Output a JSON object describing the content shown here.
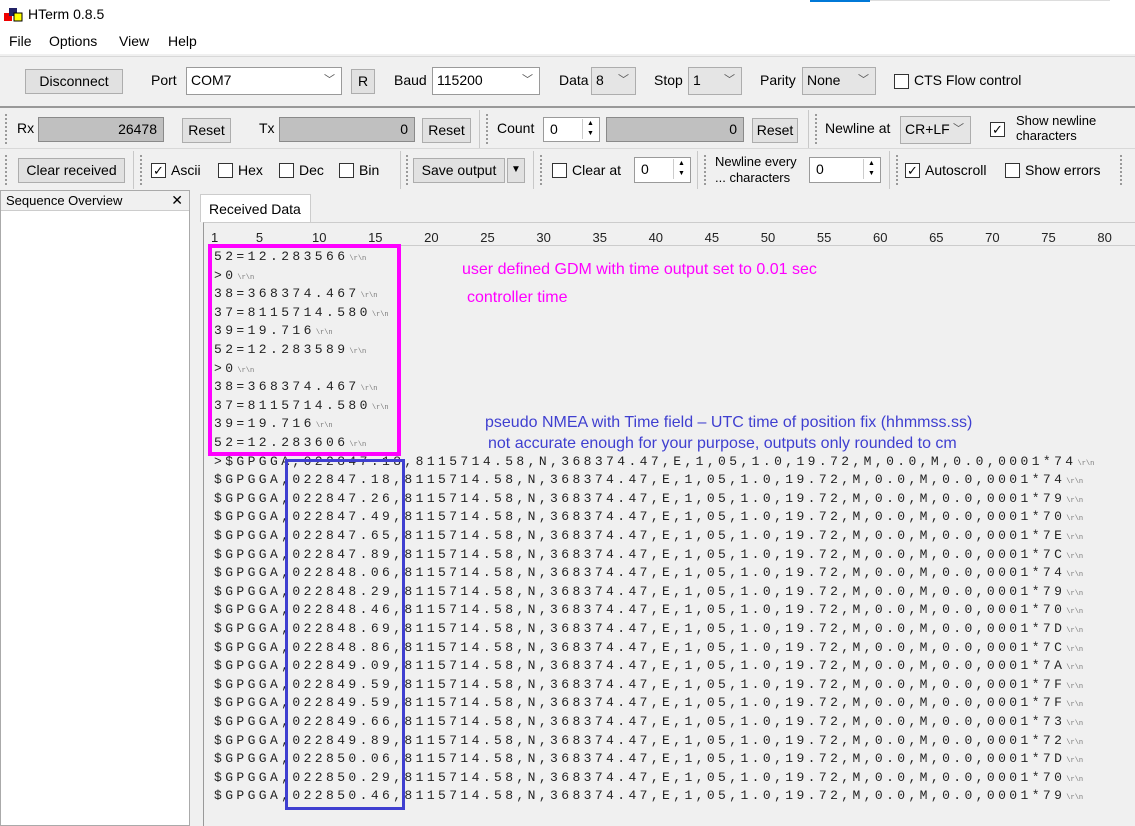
{
  "app": {
    "title": "HTerm 0.8.5"
  },
  "menu": [
    "File",
    "Options",
    "View",
    "Help"
  ],
  "connection": {
    "disconnect_label": "Disconnect",
    "port_label": "Port",
    "port_value": "COM7",
    "refresh_label": "R",
    "baud_label": "Baud",
    "baud_value": "115200",
    "data_label": "Data",
    "data_value": "8",
    "stop_label": "Stop",
    "stop_value": "1",
    "parity_label": "Parity",
    "parity_value": "None",
    "cts_label": "CTS Flow control",
    "cts_checked": false
  },
  "counters": {
    "rx_label": "Rx",
    "rx_value": "26478",
    "reset_label": "Reset",
    "tx_label": "Tx",
    "tx_value": "0",
    "count_label": "Count",
    "count_value": "0",
    "count_result": "0",
    "newline_at_label": "Newline at",
    "newline_at_value": "CR+LF",
    "show_newline_label1": "Show newline",
    "show_newline_label2": "characters",
    "show_newline_checked": true
  },
  "display": {
    "clear_received_label": "Clear received",
    "ascii_label": "Ascii",
    "hex_label": "Hex",
    "dec_label": "Dec",
    "bin_label": "Bin",
    "ascii_checked": true,
    "save_output_label": "Save output",
    "clear_at_label": "Clear at",
    "clear_at_value": "0",
    "newline_every_label1": "Newline every",
    "newline_every_label2": "... characters",
    "newline_every_value": "0",
    "autoscroll_label": "Autoscroll",
    "autoscroll_checked": true,
    "show_errors_label": "Show errors"
  },
  "sequence_overview": {
    "title": "Sequence Overview",
    "close": "✕"
  },
  "received_tab": "Received Data",
  "ruler": [
    "1",
    "5",
    "10",
    "15",
    "20",
    "25",
    "30",
    "35",
    "40",
    "45",
    "50",
    "55",
    "60",
    "65",
    "70",
    "75",
    "80"
  ],
  "newline_marker": "\\r\\n",
  "lines": [
    "52=12.283566",
    ">0",
    "38=368374.467",
    "37=8115714.580",
    "39=19.716",
    "52=12.283589",
    ">0",
    "38=368374.467",
    "37=8115714.580",
    "39=19.716",
    "52=12.283606",
    ">$GPGGA,022847.18,8115714.58,N,368374.47,E,1,05,1.0,19.72,M,0.0,M,0.0,0001*74",
    "$GPGGA,022847.18,8115714.58,N,368374.47,E,1,05,1.0,19.72,M,0.0,M,0.0,0001*74",
    "$GPGGA,022847.26,8115714.58,N,368374.47,E,1,05,1.0,19.72,M,0.0,M,0.0,0001*79",
    "$GPGGA,022847.49,8115714.58,N,368374.47,E,1,05,1.0,19.72,M,0.0,M,0.0,0001*70",
    "$GPGGA,022847.65,8115714.58,N,368374.47,E,1,05,1.0,19.72,M,0.0,M,0.0,0001*7E",
    "$GPGGA,022847.89,8115714.58,N,368374.47,E,1,05,1.0,19.72,M,0.0,M,0.0,0001*7C",
    "$GPGGA,022848.06,8115714.58,N,368374.47,E,1,05,1.0,19.72,M,0.0,M,0.0,0001*74",
    "$GPGGA,022848.29,8115714.58,N,368374.47,E,1,05,1.0,19.72,M,0.0,M,0.0,0001*79",
    "$GPGGA,022848.46,8115714.58,N,368374.47,E,1,05,1.0,19.72,M,0.0,M,0.0,0001*70",
    "$GPGGA,022848.69,8115714.58,N,368374.47,E,1,05,1.0,19.72,M,0.0,M,0.0,0001*7D",
    "$GPGGA,022848.86,8115714.58,N,368374.47,E,1,05,1.0,19.72,M,0.0,M,0.0,0001*7C",
    "$GPGGA,022849.09,8115714.58,N,368374.47,E,1,05,1.0,19.72,M,0.0,M,0.0,0001*7A",
    "$GPGGA,022849.59,8115714.58,N,368374.47,E,1,05,1.0,19.72,M,0.0,M,0.0,0001*7F",
    "$GPGGA,022849.59,8115714.58,N,368374.47,E,1,05,1.0,19.72,M,0.0,M,0.0,0001*7F",
    "$GPGGA,022849.66,8115714.58,N,368374.47,E,1,05,1.0,19.72,M,0.0,M,0.0,0001*73",
    "$GPGGA,022849.89,8115714.58,N,368374.47,E,1,05,1.0,19.72,M,0.0,M,0.0,0001*72",
    "$GPGGA,022850.06,8115714.58,N,368374.47,E,1,05,1.0,19.72,M,0.0,M,0.0,0001*7D",
    "$GPGGA,022850.29,8115714.58,N,368374.47,E,1,05,1.0,19.72,M,0.0,M,0.0,0001*70",
    "$GPGGA,022850.46,8115714.58,N,368374.47,E,1,05,1.0,19.72,M,0.0,M,0.0,0001*79"
  ],
  "annotations": {
    "gdm_line1": "user defined GDM with time output set to 0.01 sec",
    "gdm_line2": "controller time",
    "nmea_line1": "pseudo NMEA with Time field – UTC time of position fix (hhmmss.ss)",
    "nmea_line2": "not accurate enough for your purpose, outputs only rounded to cm",
    "gdm_color": "#ff00ff",
    "nmea_color": "#3f3fd0"
  }
}
